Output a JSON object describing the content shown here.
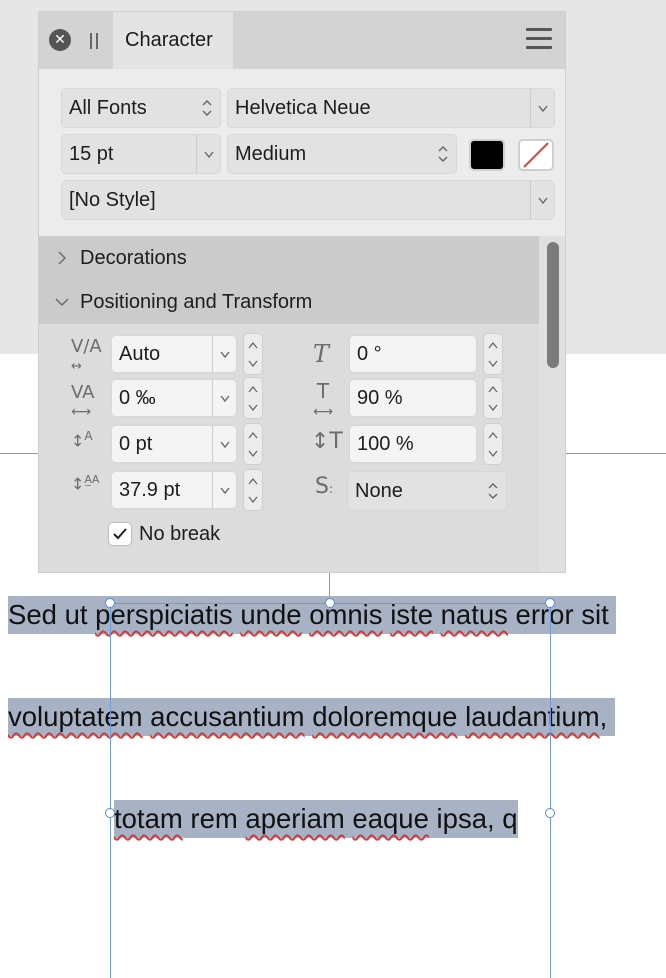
{
  "panel": {
    "title": "Character",
    "font_collection": "All Fonts",
    "font_family": "Helvetica Neue",
    "font_size": "15 pt",
    "font_weight": "Medium",
    "text_style": "[No Style]",
    "fill_color": "#000000",
    "stroke_color": "none"
  },
  "sections": {
    "decorations": "Decorations",
    "positioning": "Positioning and Transform"
  },
  "positioning": {
    "kerning": "Auto",
    "tracking": "0 ‰",
    "baseline_shift": "0 pt",
    "leading": "37.9 pt",
    "shear": "0 °",
    "horizontal_scale": "90 %",
    "vertical_scale": "100 %",
    "typographic_case": "None",
    "no_break_label": "No break",
    "no_break_checked": true
  },
  "canvas": {
    "line1": {
      "pre": "Sed ut ",
      "w1": "perspiciatis",
      "s1": " ",
      "w2": "unde",
      "s2": " ",
      "w3": "omnis",
      "s3": " ",
      "w4": "iste",
      "s4": " ",
      "w5": "natus",
      "post": " error sit"
    },
    "line2": {
      "w1": "voluptatem",
      "s1": " ",
      "w2": "accusantium",
      "s2": " ",
      "w3": "doloremque",
      "s3": " ",
      "w4": "laudantium",
      "post": ","
    },
    "line3": {
      "w1": "totam",
      "s1": " rem ",
      "w2": "aperiam",
      "s2": " ",
      "w3": "eaque",
      "post": " ipsa, q"
    }
  },
  "colors": {
    "selection": "#a7b3c4",
    "guide": "#6f9be0",
    "spellcheck": "#d23a3a"
  }
}
